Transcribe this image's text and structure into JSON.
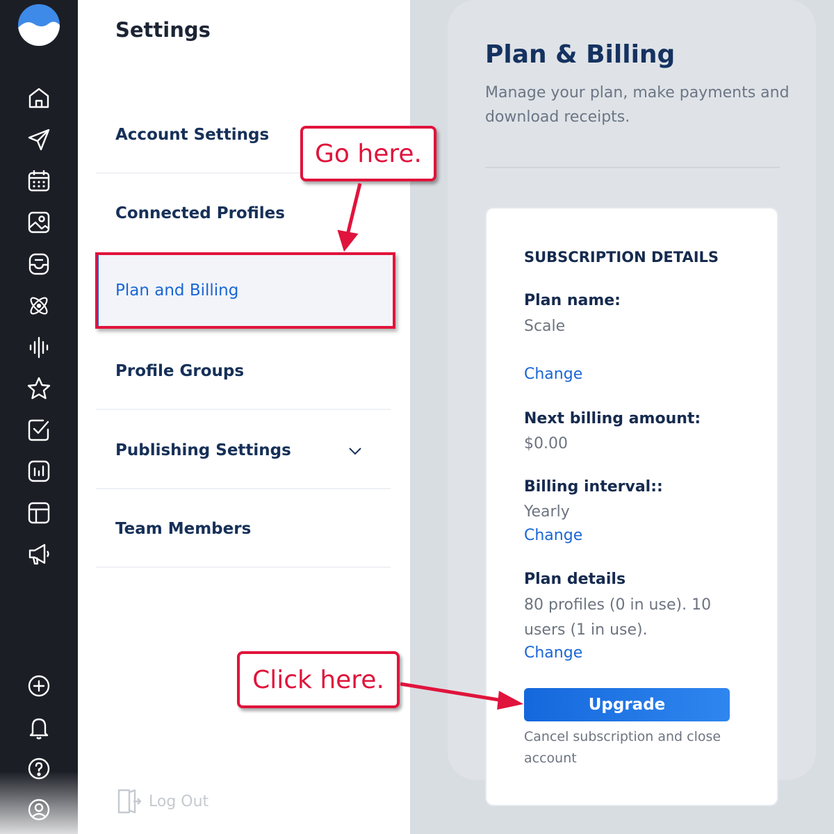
{
  "sidebar": {
    "icons": [
      "home-icon",
      "send-icon",
      "calendar-icon",
      "media-icon",
      "inbox-icon",
      "atom-icon",
      "audio-wave-icon",
      "star-icon",
      "task-check-icon",
      "analytics-icon",
      "layout-icon",
      "megaphone-icon",
      "add-icon",
      "bell-icon",
      "help-icon",
      "user-icon"
    ]
  },
  "settings_menu": {
    "title": "Settings",
    "items": [
      {
        "label": "Account Settings"
      },
      {
        "label": "Connected Profiles"
      },
      {
        "label": "Plan and Billing",
        "active": true
      },
      {
        "label": "Profile Groups"
      },
      {
        "label": "Publishing Settings",
        "has_dropdown": true
      },
      {
        "label": "Team Members"
      }
    ],
    "logout_label": "Log Out"
  },
  "billing": {
    "title": "Plan & Billing",
    "subtitle": "Manage your plan, make payments and download receipts.",
    "section_title": "SUBSCRIPTION DETAILS",
    "plan_name_label": "Plan name:",
    "plan_name_value": "Scale",
    "change_label": "Change",
    "next_billing_label": "Next billing amount:",
    "next_billing_value": "$0.00",
    "interval_label": "Billing interval::",
    "interval_value": "Yearly",
    "plan_details_label": "Plan details",
    "plan_details_line1": "80 profiles (0 in use). 10",
    "plan_details_line2": "users (1 in use).",
    "upgrade_label": "Upgrade",
    "cancel_label": "Cancel subscription and close account"
  },
  "annotations": {
    "go_here": "Go here.",
    "click_here": "Click here.",
    "color": "#e0143c"
  },
  "colors": {
    "accent": "#1a66d6",
    "navy": "#153260",
    "rail": "#1c1e26"
  }
}
